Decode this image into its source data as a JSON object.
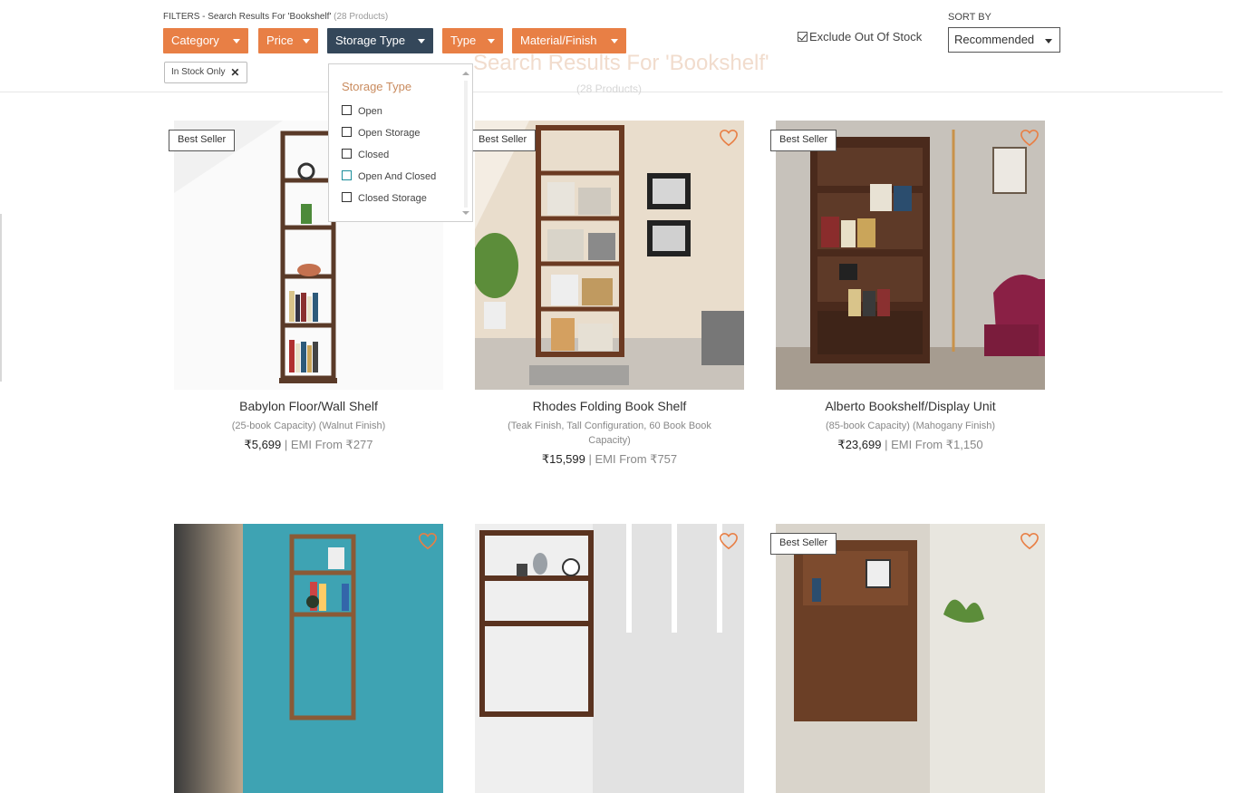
{
  "filters": {
    "heading": "FILTERS - Search Results For 'Bookshelf'",
    "count": "(28 Products)",
    "buttons": [
      {
        "label": "Category"
      },
      {
        "label": "Price"
      },
      {
        "label": "Storage Type"
      },
      {
        "label": "Type"
      },
      {
        "label": "Material/Finish"
      }
    ],
    "active_chip": "In Stock Only",
    "exclude_out_of_stock": {
      "label": "Exclude Out Of Stock",
      "checked": true
    }
  },
  "sort": {
    "label": "SORT BY",
    "value": "Recommended"
  },
  "ghost_heading": {
    "title": "Search Results For 'Bookshelf'",
    "sub": "(28 Products)"
  },
  "dropdown": {
    "title": "Storage Type",
    "options": [
      {
        "label": "Open"
      },
      {
        "label": "Open Storage"
      },
      {
        "label": "Closed"
      },
      {
        "label": "Open And Closed"
      },
      {
        "label": "Closed Storage"
      }
    ]
  },
  "products": [
    {
      "name": "Babylon Floor/Wall Shelf",
      "desc": "(25-book Capacity) (Walnut Finish)",
      "price": "₹5,699",
      "emi": "| EMI From ₹277",
      "badge": "Best Seller"
    },
    {
      "name": "Rhodes Folding Book Shelf",
      "desc": "(Teak Finish, Tall Configuration, 60 Book Book Capacity)",
      "price": "₹15,599",
      "emi": "| EMI From ₹757",
      "badge": "Best Seller"
    },
    {
      "name": "Alberto Bookshelf/Display Unit",
      "desc": "(85-book Capacity) (Mahogany Finish)",
      "price": "₹23,699",
      "emi": "| EMI From ₹1,150",
      "badge": "Best Seller"
    },
    {
      "name": "",
      "desc": "",
      "price": "",
      "emi": "",
      "badge": ""
    },
    {
      "name": "",
      "desc": "",
      "price": "",
      "emi": "",
      "badge": ""
    },
    {
      "name": "",
      "desc": "",
      "price": "",
      "emi": "",
      "badge": "Best Seller"
    }
  ],
  "colors": {
    "accent": "#e87f45",
    "active_filter": "#34475a",
    "heart": "#e87f45"
  }
}
